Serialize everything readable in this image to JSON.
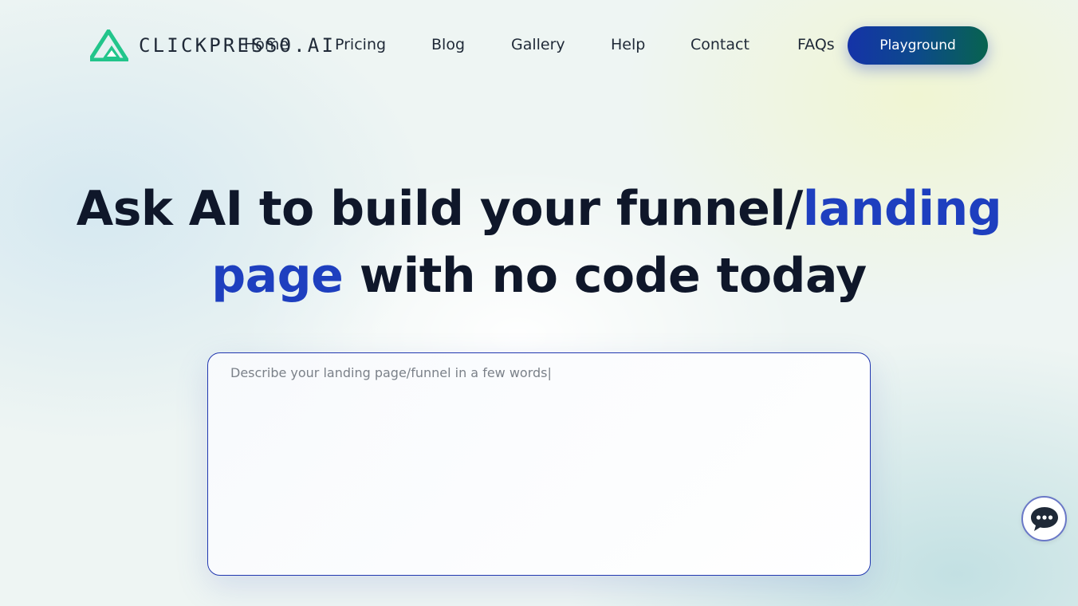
{
  "brand": {
    "name": "CLICKPRESSO.AI",
    "logo_icon": "triangle-logo-icon",
    "color": "#22c58b"
  },
  "nav": {
    "items": [
      {
        "label": "Home"
      },
      {
        "label": "Pricing"
      },
      {
        "label": "Blog"
      },
      {
        "label": "Gallery"
      },
      {
        "label": "Help"
      },
      {
        "label": "Contact"
      },
      {
        "label": "FAQs"
      }
    ],
    "cta_label": "Playground"
  },
  "hero": {
    "part1": "Ask AI to build your funnel/",
    "accent1": "landing",
    "accent2": "page",
    "part2": " with no code today",
    "accent_color": "#1e3fbf"
  },
  "prompt": {
    "placeholder": "Describe your landing page/funnel in a few words|",
    "value": ""
  },
  "chat_widget": {
    "icon": "chat-bubble-icon"
  }
}
